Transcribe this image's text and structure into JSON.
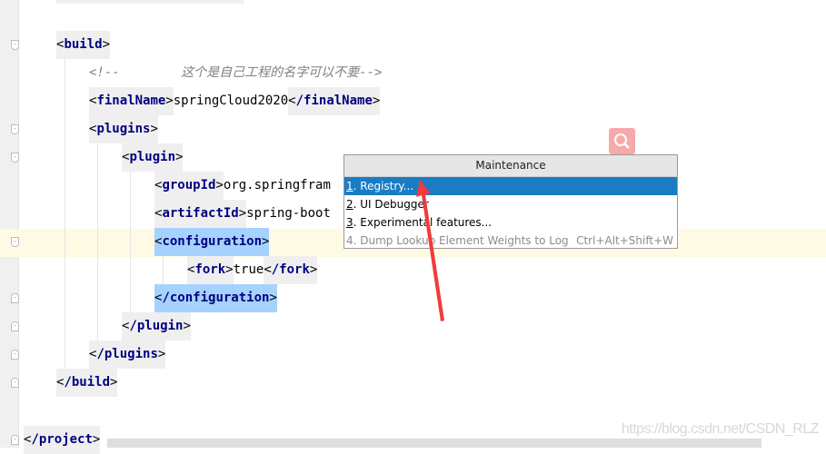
{
  "editor": {
    "lines": [
      {
        "level": 0,
        "center": 49,
        "tokens": [
          {
            "k": "tag",
            "t": "build"
          }
        ],
        "fold": "start"
      },
      {
        "level": 1,
        "center": 80,
        "tokens": [
          {
            "k": "comment",
            "t": "<!--        这个是自己工程的名字可以不要-->"
          }
        ]
      },
      {
        "level": 1,
        "center": 111,
        "tokens": [
          {
            "k": "tag",
            "t": "finalName"
          },
          {
            "k": "txt",
            "t": "springCloud2020"
          },
          {
            "k": "tag",
            "t": "/finalName"
          }
        ]
      },
      {
        "level": 1,
        "center": 142,
        "tokens": [
          {
            "k": "tag",
            "t": "plugins"
          }
        ],
        "fold": "start"
      },
      {
        "level": 2,
        "center": 173,
        "tokens": [
          {
            "k": "tag",
            "t": "plugin"
          }
        ],
        "fold": "start"
      },
      {
        "level": 3,
        "center": 204,
        "tokens": [
          {
            "k": "tag",
            "t": "groupId"
          },
          {
            "k": "txt",
            "t": "org.springfram"
          }
        ]
      },
      {
        "level": 3,
        "center": 235,
        "tokens": [
          {
            "k": "tag",
            "t": "artifactId"
          },
          {
            "k": "txt",
            "t": "spring-boot"
          }
        ]
      },
      {
        "level": 3,
        "center": 266,
        "tokens": [
          {
            "k": "tag sel",
            "t": "configuration"
          }
        ],
        "fold": "start"
      },
      {
        "level": 4,
        "center": 297,
        "tokens": [
          {
            "k": "tag",
            "t": "fork"
          },
          {
            "k": "txt",
            "t": "true"
          },
          {
            "k": "tag",
            "t": "/fork"
          }
        ]
      },
      {
        "level": 3,
        "center": 328,
        "tokens": [
          {
            "k": "tag sel",
            "t": "/configuration"
          }
        ],
        "fold": "end"
      },
      {
        "level": 2,
        "center": 359,
        "tokens": [
          {
            "k": "tag",
            "t": "/plugin"
          }
        ],
        "fold": "end"
      },
      {
        "level": 1,
        "center": 390,
        "tokens": [
          {
            "k": "tag",
            "t": "/plugins"
          }
        ],
        "fold": "end"
      },
      {
        "level": 0,
        "center": 421,
        "tokens": [
          {
            "k": "tag",
            "t": "/build"
          }
        ],
        "fold": "end"
      },
      {
        "level": -1,
        "center": 484,
        "tokens": [
          {
            "k": "tag",
            "t": "/project"
          }
        ],
        "fold": "end"
      }
    ]
  },
  "popup": {
    "title": "Maintenance",
    "items": [
      {
        "mnemonic": "1",
        "label": ". Registry...",
        "shortcut": "",
        "state": "active"
      },
      {
        "mnemonic": "2",
        "label": ". UI Debugger",
        "shortcut": "",
        "state": "normal"
      },
      {
        "mnemonic": "3",
        "label": ". Experimental features...",
        "shortcut": "",
        "state": "normal"
      },
      {
        "mnemonic": "",
        "label": "4. Dump Lookup Element Weights to Log",
        "shortcut": "Ctrl+Alt+Shift+W",
        "state": "disabled"
      }
    ]
  },
  "watermark": "https://blog.csdn.net/CSDN_RLZ",
  "colors": {
    "accent": "#1a7dc4",
    "annotation_arrow": "#f03c3c",
    "tag": "#000080"
  }
}
